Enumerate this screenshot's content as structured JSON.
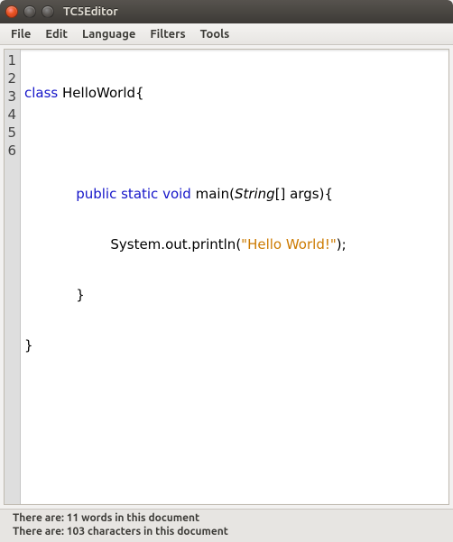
{
  "window": {
    "title": "TC5Editor"
  },
  "menubar": {
    "items": [
      "File",
      "Edit",
      "Language",
      "Filters",
      "Tools"
    ]
  },
  "editor": {
    "line_numbers": [
      "1",
      "2",
      "3",
      "4",
      "5",
      "6"
    ],
    "lines": {
      "l1": {
        "kw": "class",
        "rest": " HelloWorld{"
      },
      "l2": {
        "text": " "
      },
      "l3": {
        "indent": "            ",
        "kw": "public static void",
        "mid": " main(",
        "ital": "String",
        "after": "[] args){"
      },
      "l4": {
        "indent": "                    System.out.println(",
        "str": "\"Hello World!\"",
        "after": ");"
      },
      "l5": {
        "text": "            }"
      },
      "l6": {
        "text": "}"
      }
    }
  },
  "status": {
    "line1": "There are: 11 words in this document",
    "line2": "There are: 103 characters in this document"
  }
}
